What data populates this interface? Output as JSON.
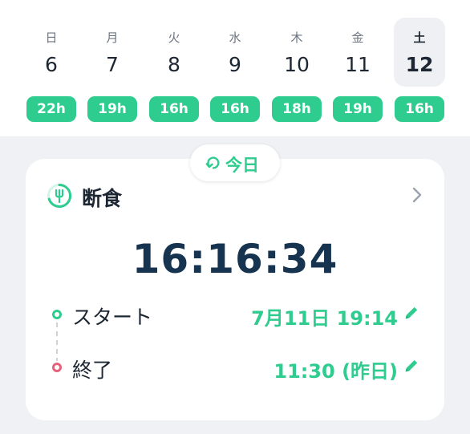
{
  "calendar": {
    "days": [
      {
        "weekday": "日",
        "date": "6",
        "hours": "22h"
      },
      {
        "weekday": "月",
        "date": "7",
        "hours": "19h"
      },
      {
        "weekday": "火",
        "date": "8",
        "hours": "16h"
      },
      {
        "weekday": "水",
        "date": "9",
        "hours": "16h"
      },
      {
        "weekday": "木",
        "date": "10",
        "hours": "18h"
      },
      {
        "weekday": "金",
        "date": "11",
        "hours": "19h"
      },
      {
        "weekday": "土",
        "date": "12",
        "hours": "16h",
        "selected": true
      }
    ]
  },
  "today_button": {
    "label": "今日"
  },
  "fasting": {
    "title": "断食",
    "elapsed": "16:16:34",
    "start": {
      "label": "スタート",
      "value": "7月11日 19:14"
    },
    "end": {
      "label": "終了",
      "value": "11:30 (昨日)"
    }
  },
  "colors": {
    "accent": "#2ecc8e",
    "end_dot": "#e5627a",
    "timer": "#163450"
  }
}
